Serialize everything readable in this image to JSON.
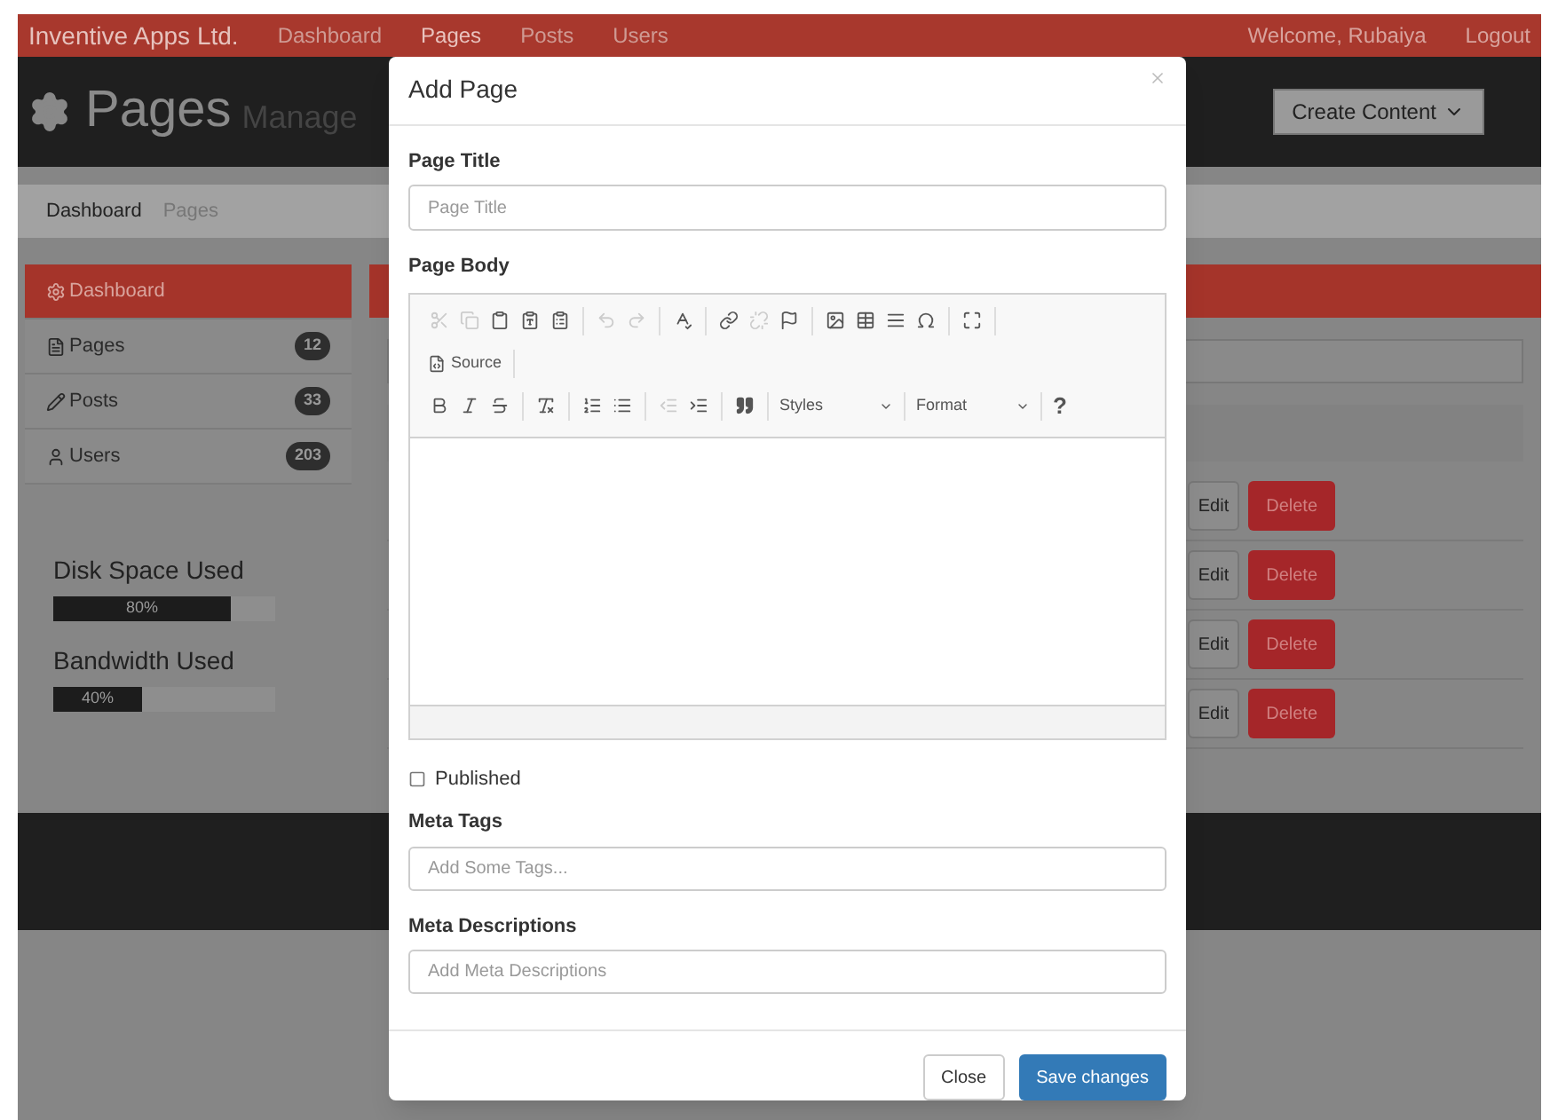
{
  "navbar": {
    "brand": "Inventive Apps Ltd.",
    "links": [
      {
        "label": "Dashboard",
        "selected": false
      },
      {
        "label": "Pages",
        "selected": true
      },
      {
        "label": "Posts",
        "selected": false
      },
      {
        "label": "Users",
        "selected": false
      }
    ],
    "welcome": "Welcome, Rubaiya",
    "logout": "Logout"
  },
  "header": {
    "title": "Pages",
    "subtitle": "Manage",
    "create_button": "Create Content"
  },
  "breadcrumb": [
    "Dashboard",
    "Pages"
  ],
  "sidebar": {
    "items": [
      {
        "label": "Dashboard",
        "selected": true
      },
      {
        "label": "Pages",
        "count": "12",
        "selected": false
      },
      {
        "label": "Posts",
        "count": "33",
        "selected": false
      },
      {
        "label": "Users",
        "count": "203",
        "selected": false
      }
    ]
  },
  "meters": [
    {
      "label": "Disk Space Used",
      "level": 0.8,
      "reading": "80%"
    },
    {
      "label": "Bandwidth Used",
      "level": 0.4,
      "reading": "40%"
    }
  ],
  "rows": [
    {
      "edit": "Edit",
      "delete": "Delete"
    },
    {
      "edit": "Edit",
      "delete": "Delete"
    },
    {
      "edit": "Edit",
      "delete": "Delete"
    },
    {
      "edit": "Edit",
      "delete": "Delete"
    }
  ],
  "modal": {
    "title": "Add Page",
    "page_title": {
      "label": "Page Title",
      "placeholder": "Page Title"
    },
    "page_body": {
      "label": "Page Body",
      "tools": [
        {
          "disabled": true
        },
        {
          "disabled": true
        },
        {
          "disabled": false
        },
        {
          "disabled": false
        },
        {
          "disabled": false
        },
        {
          "disabled": true
        },
        {
          "disabled": true
        },
        {
          "disabled": false
        },
        {
          "disabled": false
        },
        {
          "disabled": true
        },
        {
          "disabled": false
        },
        {
          "disabled": false
        },
        {
          "disabled": false
        },
        {
          "disabled": false
        },
        {
          "disabled": false
        },
        {
          "disabled": false
        }
      ],
      "source": "Source",
      "styles": "Styles",
      "format": "Format",
      "help": "?"
    },
    "published": {
      "label": "Published",
      "checked": false
    },
    "meta_tags": {
      "label": "Meta Tags",
      "placeholder": "Add Some Tags..."
    },
    "meta_descriptions": {
      "label": "Meta Descriptions",
      "placeholder": "Add Meta Descriptions"
    },
    "buttons": {
      "close": "Close",
      "save": "Save changes"
    }
  }
}
